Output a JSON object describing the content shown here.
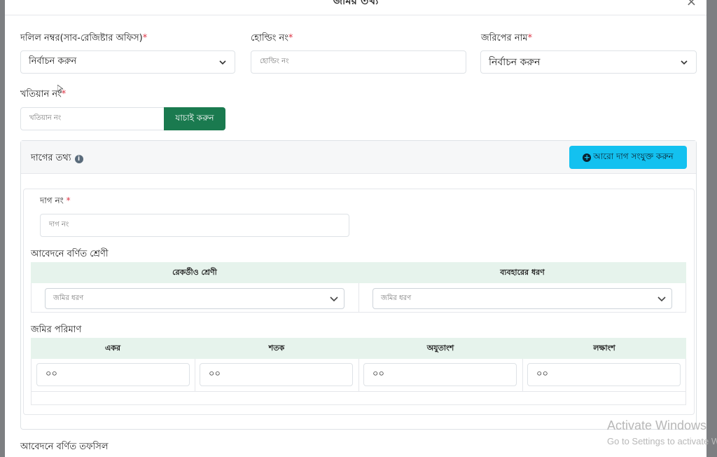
{
  "modal": {
    "title": "জমির তথ্য",
    "close_label": "×"
  },
  "form": {
    "deed_label": "দলিল নম্বর(সাব-রেজিষ্টার অফিস)",
    "deed_value": "নির্বাচন করুন",
    "holding_label": "হোল্ডিং নং",
    "holding_placeholder": "হোল্ডিং নং",
    "survey_label": "জরিপের নাম",
    "survey_value": "নির্বাচন করুন",
    "khatian_label": "খতিয়ান নং",
    "khatian_placeholder": "খতিয়ান নং",
    "verify_button": "যাচাই করুন",
    "required_mark": "*"
  },
  "dag_card": {
    "title": "দাগের তথ্য",
    "info_glyph": "i",
    "add_button": "আরো দাগ সংযুক্ত করুন",
    "plus_glyph": "+",
    "dag_label": "দাগ নং",
    "dag_placeholder": "দাগ নং",
    "class_section_label": "আবেদনে বর্ণিত শ্রেণী",
    "class_headers": [
      "রেকর্ডীও শ্রেণী",
      "ব্যবহারের ধরণ"
    ],
    "class_selects": [
      "জমির ধরণ",
      "জমির ধরণ"
    ],
    "amount_section_label": "জমির পরিমাণ",
    "amount_headers": [
      "একর",
      "শতক",
      "অযুতাংশ",
      "লক্ষাংশ"
    ],
    "amount_values": [
      "০০",
      "০০",
      "০০",
      "০০"
    ]
  },
  "footer_label": "আবেদনে বর্ণিত তফসিল",
  "watermark": {
    "line1": "Activate Windows",
    "line2": "Go to Settings to activate Windows."
  }
}
